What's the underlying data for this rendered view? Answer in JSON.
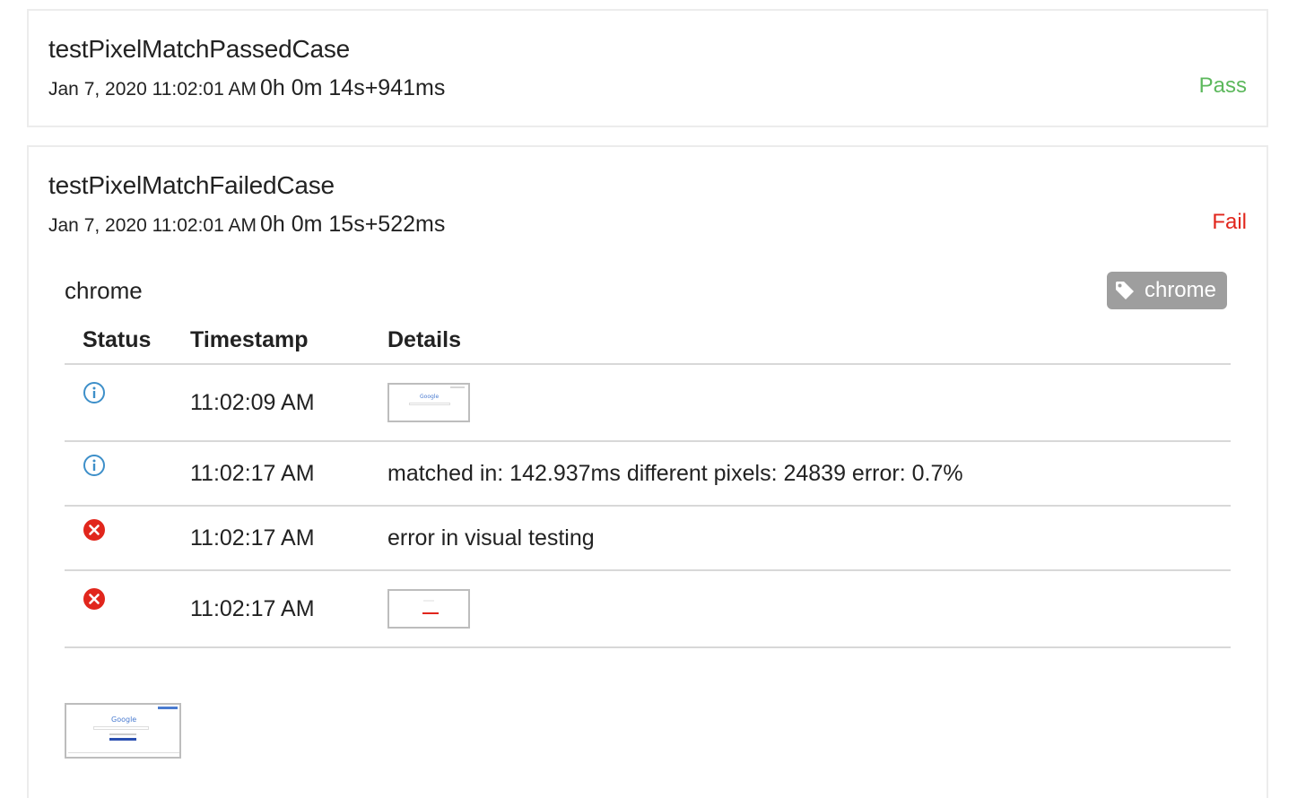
{
  "tests": [
    {
      "name": "testPixelMatchPassedCase",
      "date": "Jan 7, 2020 11:02:01 AM",
      "duration": "0h 0m 14s+941ms",
      "status": "Pass"
    },
    {
      "name": "testPixelMatchFailedCase",
      "date": "Jan 7, 2020 11:02:01 AM",
      "duration": "0h 0m 15s+522ms",
      "status": "Fail",
      "node": {
        "name": "chrome",
        "tag_label": "chrome",
        "tag_icon": "tag-icon",
        "columns": [
          "Status",
          "Timestamp",
          "Details"
        ],
        "logs": [
          {
            "status_icon": "info-icon",
            "timestamp": "11:02:09 AM",
            "details": "",
            "thumbnail": "google-screenshot"
          },
          {
            "status_icon": "info-icon",
            "timestamp": "11:02:17 AM",
            "details": "matched in: 142.937ms different pixels: 24839 error: 0.7%"
          },
          {
            "status_icon": "error-icon",
            "timestamp": "11:02:17 AM",
            "details": "error in visual testing"
          },
          {
            "status_icon": "error-icon",
            "timestamp": "11:02:17 AM",
            "details": "",
            "thumbnail": "diff-screenshot"
          }
        ],
        "thumb_text": "Google"
      }
    }
  ],
  "colors": {
    "pass": "#5cb85c",
    "fail": "#e1261c",
    "info": "#3d8fc9",
    "tag_bg": "#9e9e9e"
  }
}
